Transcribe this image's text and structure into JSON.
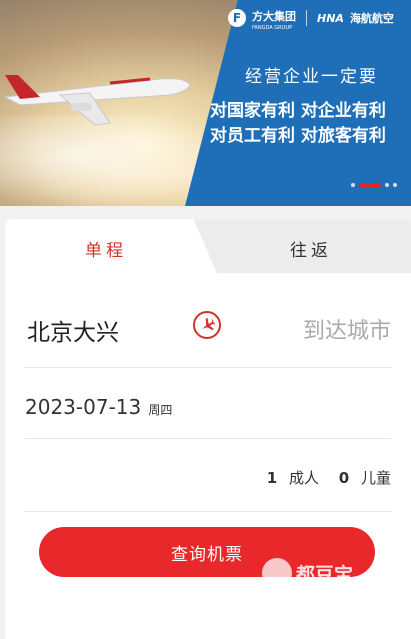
{
  "banner": {
    "logo_mark": "F",
    "logo_name": "方大集团",
    "logo_sub": "FANGDA GROUP",
    "airline_code": "HNA",
    "airline_name": "海航航空",
    "headline": "经营企业一定要",
    "slogan_line1": "对国家有利  对企业有利",
    "slogan_line2": "对员工有利  对旅客有利",
    "colors": {
      "panel": "#1f6fb8",
      "accent": "#e0271d"
    }
  },
  "tabs": [
    {
      "label": "单程",
      "active": true
    },
    {
      "label": "往返",
      "active": false
    }
  ],
  "search_form": {
    "from_city": "北京大兴",
    "to_city_placeholder": "到达城市",
    "swap_icon": "airplane-swap-icon",
    "date": "2023-07-13",
    "weekday": "周四",
    "adult_count": "1",
    "adult_label": "成人",
    "child_count": "0",
    "child_label": "儿童",
    "search_label": "查询机票",
    "accent": "#e8282a"
  },
  "watermark": {
    "text": "都豆宝"
  }
}
